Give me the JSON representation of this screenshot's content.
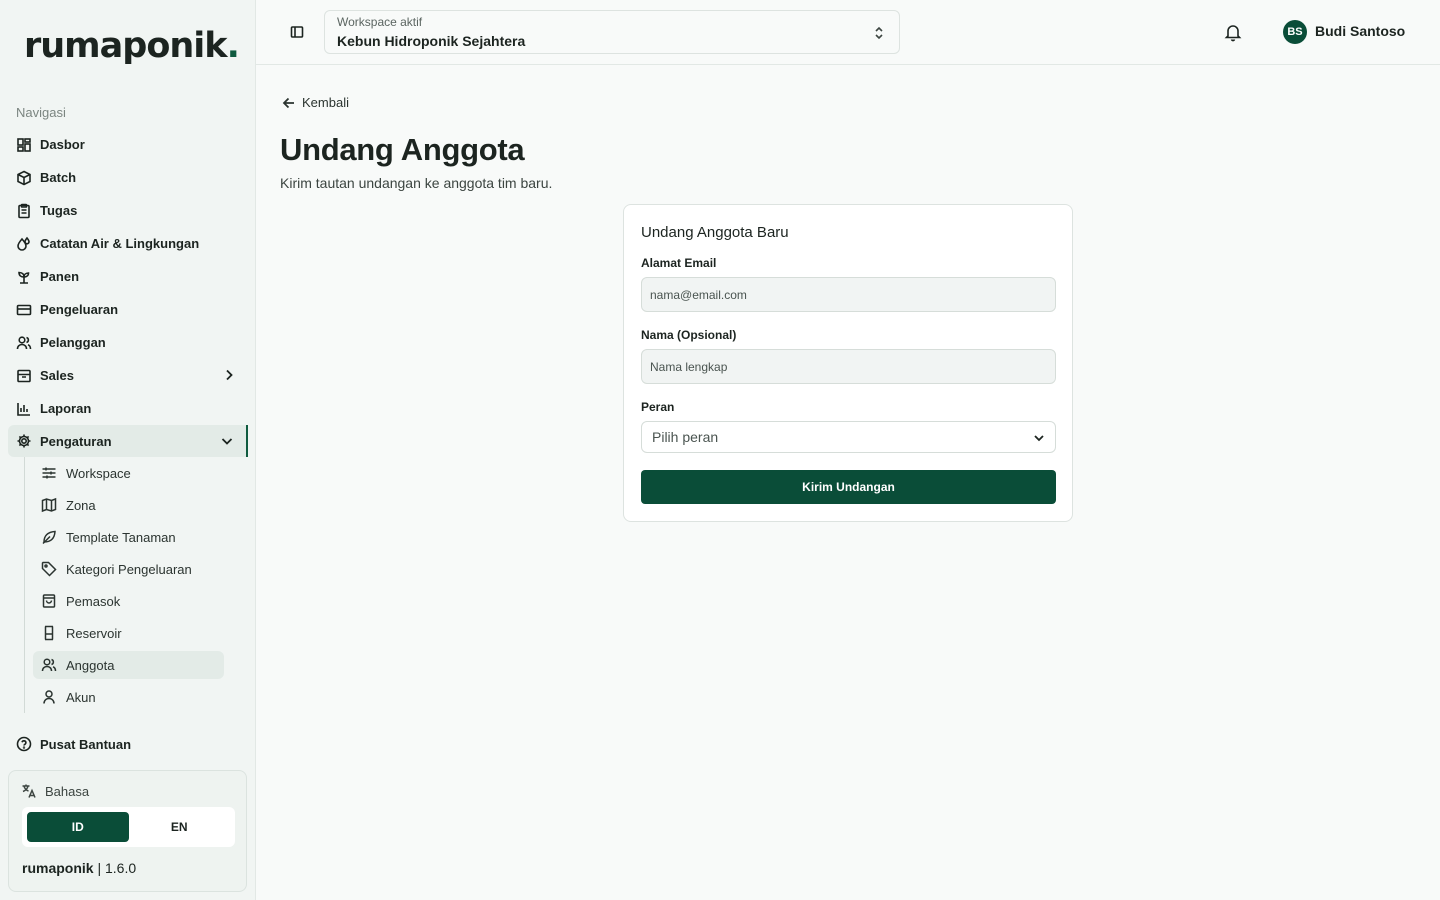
{
  "brand": {
    "logo_main": "rumaponik",
    "logo_dot": "."
  },
  "sidebar": {
    "section_label": "Navigasi",
    "items": [
      {
        "label": "Dasbor",
        "icon": "dashboard-icon"
      },
      {
        "label": "Batch",
        "icon": "box-icon"
      },
      {
        "label": "Tugas",
        "icon": "clipboard-icon"
      },
      {
        "label": "Catatan Air & Lingkungan",
        "icon": "droplet-icon"
      },
      {
        "label": "Panen",
        "icon": "sprout-icon"
      },
      {
        "label": "Pengeluaran",
        "icon": "credit-card-icon"
      },
      {
        "label": "Pelanggan",
        "icon": "users-icon"
      },
      {
        "label": "Sales",
        "icon": "archive-icon"
      },
      {
        "label": "Laporan",
        "icon": "bar-chart-icon"
      },
      {
        "label": "Pengaturan",
        "icon": "gear-icon"
      }
    ],
    "sub_items": [
      {
        "label": "Workspace",
        "icon": "sliders-icon"
      },
      {
        "label": "Zona",
        "icon": "map-icon"
      },
      {
        "label": "Template Tanaman",
        "icon": "leaf-icon"
      },
      {
        "label": "Kategori Pengeluaran",
        "icon": "tag-icon"
      },
      {
        "label": "Pemasok",
        "icon": "shopping-bag-icon"
      },
      {
        "label": "Reservoir",
        "icon": "container-icon"
      },
      {
        "label": "Anggota",
        "icon": "users-icon"
      },
      {
        "label": "Akun",
        "icon": "user-icon"
      }
    ],
    "help_label": "Pusat Bantuan",
    "language": {
      "label": "Bahasa",
      "options": [
        "ID",
        "EN"
      ],
      "selected": "ID"
    },
    "version": {
      "name": "rumaponik",
      "separator": "|",
      "number": "1.6.0"
    }
  },
  "header": {
    "workspace_label": "Workspace aktif",
    "workspace_value": "Kebun Hidroponik Sejahtera",
    "user_initials": "BS",
    "user_name": "Budi Santoso"
  },
  "main": {
    "back_label": "Kembali",
    "title": "Undang Anggota",
    "subtitle": "Kirim tautan undangan ke anggota tim baru.",
    "form": {
      "title": "Undang Anggota Baru",
      "email_label": "Alamat Email",
      "email_placeholder": "nama@email.com",
      "name_label": "Nama (Opsional)",
      "name_placeholder": "Nama lengkap",
      "role_label": "Peran",
      "role_placeholder": "Pilih peran",
      "submit_label": "Kirim Undangan"
    }
  },
  "colors": {
    "accent": "#0a4d38",
    "sidebar_bg": "#f1f5f3",
    "page_bg": "#f8faf9"
  }
}
